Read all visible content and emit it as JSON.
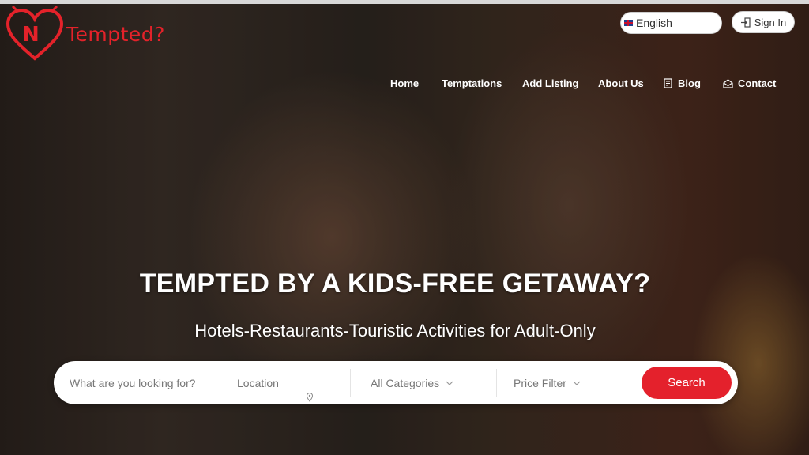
{
  "brand": {
    "name": "Tempted?",
    "color": "#e4222a"
  },
  "top_controls": {
    "language": "English",
    "sign_in": "Sign In"
  },
  "nav": [
    {
      "label": "Home",
      "icon": null
    },
    {
      "label": "Temptations",
      "icon": null
    },
    {
      "label": "Add Listing",
      "icon": null
    },
    {
      "label": "About Us",
      "icon": null
    },
    {
      "label": "Blog",
      "icon": "document-icon"
    },
    {
      "label": "Contact",
      "icon": "envelope-icon"
    }
  ],
  "hero": {
    "headline": "TEMPTED BY A KIDS-FREE GETAWAY?",
    "subhead": "Hotels-Restaurants-Touristic Activities for Adult-Only"
  },
  "search": {
    "keyword_placeholder": "What are you looking for?",
    "location_placeholder": "Location",
    "category_selected": "All Categories",
    "price_selected": "Price Filter",
    "button_label": "Search",
    "button_color": "#e4212c"
  }
}
